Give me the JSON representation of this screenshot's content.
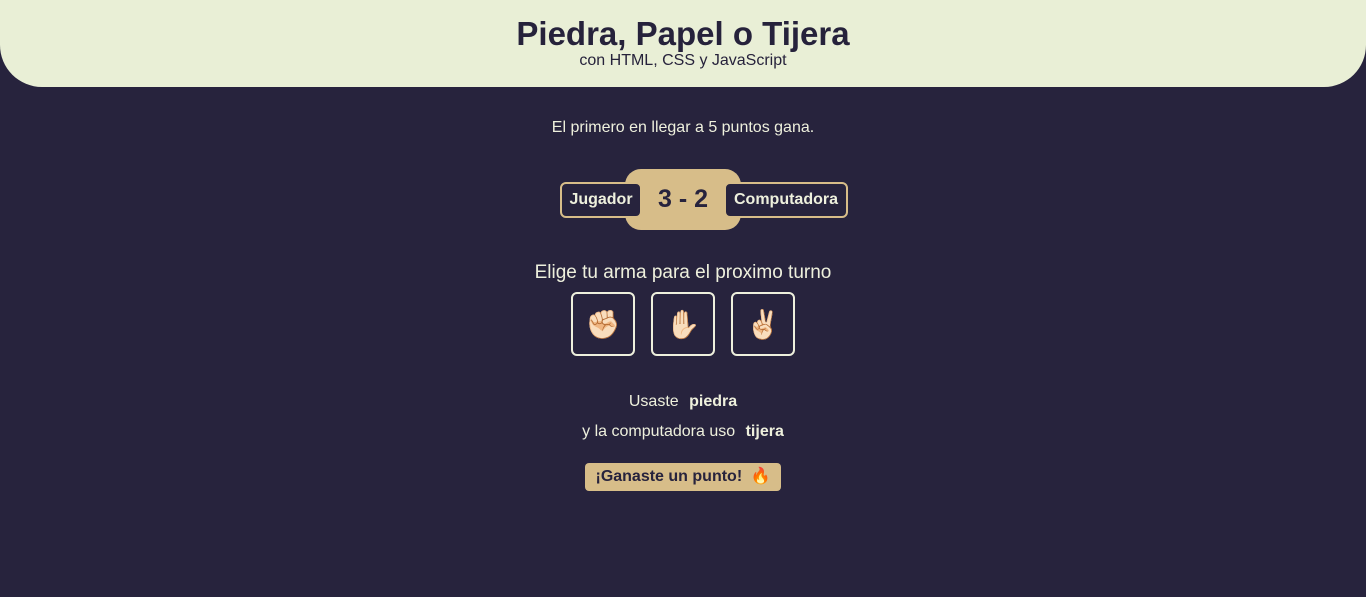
{
  "header": {
    "title": "Piedra, Papel o Tijera",
    "subtitle": "con HTML, CSS y JavaScript"
  },
  "rules": "El primero en llegar a 5 puntos gana.",
  "score": {
    "player_label": "Jugador",
    "cpu_label": "Computadora",
    "display": "3 - 2",
    "player_points": 3,
    "cpu_points": 2
  },
  "choose_prompt": "Elige tu arma para el proximo turno",
  "weapons": [
    {
      "name": "piedra",
      "glyph": "✊🏻",
      "icon": "fist-icon"
    },
    {
      "name": "papel",
      "glyph": "✋🏻",
      "icon": "open-hand-icon"
    },
    {
      "name": "tijera",
      "glyph": "✌🏻",
      "icon": "victory-hand-icon"
    }
  ],
  "last_round": {
    "player_prefix": "Usaste",
    "player_choice": "piedra",
    "cpu_prefix": "y la computadora uso",
    "cpu_choice": "tijera"
  },
  "result": {
    "text": "¡Ganaste un punto!",
    "emoji": "🔥",
    "icon": "fire-icon"
  },
  "colors": {
    "background": "#27233d",
    "header": "#e9efd6",
    "accent": "#d7bd89",
    "text": "#eef0dd"
  }
}
